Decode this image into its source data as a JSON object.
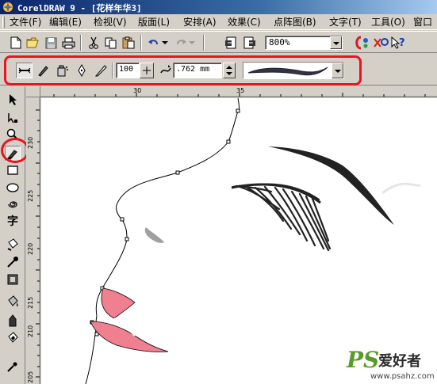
{
  "window": {
    "title": "CorelDRAW 9 - [花样年华3]"
  },
  "menu": {
    "items": [
      "文件(F)",
      "编辑(E)",
      "检视(V)",
      "版面(L)",
      "安排(A)",
      "效果(C)",
      "点阵图(B)",
      "文字(T)",
      "工具(O)",
      "窗口"
    ]
  },
  "toolbar": {
    "zoom_value": "800%"
  },
  "property_bar": {
    "width_value": "100",
    "stroke_width": ".762 mm"
  },
  "rulers": {
    "top_labels": [
      "30",
      "35"
    ],
    "left_labels": [
      "230",
      "225",
      "220",
      "215",
      "210",
      "205"
    ]
  },
  "watermark": {
    "brand": "PS",
    "chinese": "爱好者",
    "url": "www.psahz.com"
  },
  "colors": {
    "highlight": "#e8141e",
    "lips": "#f0808a",
    "title_bar": "#0a246a"
  }
}
